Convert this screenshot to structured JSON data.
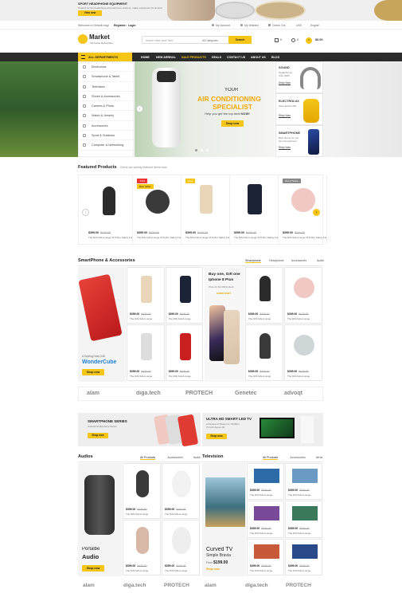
{
  "promo_top": {
    "line1": "SPORT HEADPHONE EQUIPMENT",
    "line2": "Product for the headphone and earphone workout, maker equipment for limited!",
    "button": "View now"
  },
  "topbar": {
    "welcome": "Welcome to Default msg!",
    "register": "Register",
    "or": "or",
    "login": "Login",
    "my_account": "My Account",
    "my_wishlist": "My Wishlist",
    "checkout": "Check Out",
    "currency": "USD",
    "language": "English"
  },
  "header": {
    "logo_name": "Market",
    "logo_tag": "Wholesale Marketplace",
    "search_placeholder": "Search entire store here...",
    "category_select": "All Categories",
    "search_button": "Search",
    "compare_count": "0",
    "wishlist_count": "0",
    "cart_count": "0",
    "cart_total": "$0.00"
  },
  "nav": {
    "departments": "ALL DEPARTMENTS",
    "items": [
      "HOME",
      "NEW ARRIVAL",
      "SALE PRODUCTS",
      "DEALS",
      "CONTACT US",
      "ABOUT US",
      "BLOG"
    ]
  },
  "departments": [
    "Electronics",
    "Smartphone & Tablet",
    "Television",
    "Shoes & Accessories",
    "Camera & Photo",
    "Watch & Jewelry",
    "Accessories",
    "Sport & Outdoors",
    "Computer & Networking"
  ],
  "hero": {
    "kicker": "YOUR",
    "title1": "AIR CONDITIONING",
    "title2": "SPECIALIST",
    "sub_pre": "Help you get the top deal",
    "sub_now": "NOW!",
    "button": "Shop now"
  },
  "side_ads": [
    {
      "t1": "SOUND",
      "t2": "Headphones",
      "t3": "COL:4000",
      "btn": "Shop Now"
    },
    {
      "t1": "ELECTROLUX",
      "t2": "Save Electric Bill",
      "btn": "Shop Now"
    },
    {
      "t1": "SMARTPHONE",
      "t2": "Best phone for you",
      "t3": "best Smartphone",
      "btn": "Shop Now"
    }
  ],
  "featured": {
    "title": "Featured Products",
    "subtitle": "Check our weekly featured items now!",
    "items": [
      {
        "price": "$399.00",
        "old": "$420.00",
        "name": "The DiSi SALA range Of Pytho Safety Full Tools",
        "badge": ""
      },
      {
        "price": "$399.00",
        "old": "$420.00",
        "name": "The DiSi SALA range Of Pytho Safety Full Tools",
        "badge": "-15%"
      },
      {
        "price": "$399.00",
        "old": "$420.00",
        "name": "The DiSi SALA range Of Pytho Safety Full Tools",
        "badge": "New"
      },
      {
        "price": "$399.00",
        "old": "$420.00",
        "name": "The DiSi SALA range Of Pytho Safety Full Tools",
        "badge": ""
      },
      {
        "price": "$399.00",
        "old": "$420.00",
        "name": "The DiSi SALA range Of Pytho Safety Full Tools",
        "badge": "Out of Stock"
      }
    ],
    "badge2b": "Best Seller"
  },
  "smartphone": {
    "title": "SmartPhone & Accessories",
    "tabs": [
      "Smartphone",
      "Headphone",
      "Accessories",
      "Audio"
    ],
    "promo": {
      "small": "A Keyring Does It All",
      "big": "WonderCube",
      "btn": "Shop now"
    },
    "center": {
      "t1": "Buy one, Gift one",
      "t2": "Iphone 8 Plus",
      "t3": "Price for $1,399 limited!",
      "btn": "Learn more"
    },
    "price": "$399.00",
    "old": "$420.00",
    "name": "The DiSi SALA range"
  },
  "brands": [
    "alam",
    "diga.tech",
    "PROTECH",
    "Genetec",
    "advoqt"
  ],
  "banners": {
    "left": {
      "title": "SMARTPHONE SERIES",
      "sub": "Android Smartphone Series",
      "btn": "Shop now"
    },
    "right": {
      "title": "ULTRA HD SMART LED TV",
      "sub": "A Review of Sharp LC-70UD1U",
      "sub2": "70 Inch Aquos 4K",
      "btn": "Shop now"
    }
  },
  "audios": {
    "title": "Audios",
    "tabs": [
      "All Products",
      "Accessories",
      "Audio"
    ],
    "promo_small": "Portalbe",
    "promo_big": "Audio",
    "btn": "Shop now",
    "price": "$399.00",
    "old": "$420.00",
    "name": "The DiSi SALA range"
  },
  "tv": {
    "title": "Television",
    "tabs": [
      "All Products",
      "Accessories",
      "Items"
    ],
    "promo_big": "Curved TV",
    "promo_small": "Simple Bravia",
    "from": "From",
    "promo_price": "$199.00",
    "btn": "Shop now",
    "price": "$399.00",
    "old": "$420.00",
    "name": "The DiSi SALA range"
  },
  "brands_bottom": [
    "alam",
    "diga.tech",
    "PROTECH",
    "alam",
    "diga.tech",
    "PROTECH"
  ],
  "colors": {
    "accent": "#f5c518",
    "nav_dark": "#2b2b2b",
    "hero_title": "#f5a800"
  }
}
